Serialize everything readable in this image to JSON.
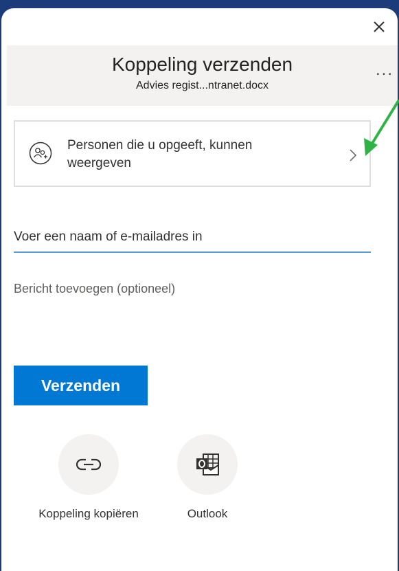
{
  "dialog": {
    "title": "Koppeling verzenden",
    "file_name": "Advies regist...ntranet.docx",
    "more_label": "...",
    "permission": {
      "text": "Personen die u opgeeft, kunnen weergeven"
    },
    "recipient_input": {
      "placeholder": "Voer een naam of e-mailadres in",
      "value": ""
    },
    "message_input": {
      "placeholder": "Bericht toevoegen (optioneel)",
      "value": ""
    },
    "send_label": "Verzenden",
    "share_options": [
      {
        "label": "Koppeling kopiëren",
        "icon": "link-icon"
      },
      {
        "label": "Outlook",
        "icon": "outlook-icon"
      }
    ]
  },
  "colors": {
    "background": "#1b3b7a",
    "accent": "#0078d4",
    "annotation_arrow": "#2fb344"
  }
}
